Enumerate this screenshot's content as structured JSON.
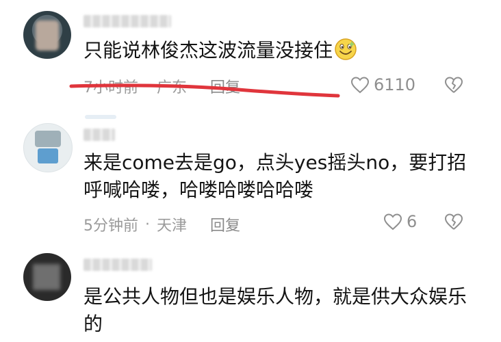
{
  "comments": [
    {
      "text": "只能说林俊杰这波流量没接住",
      "time": "7小时前",
      "sep": "·",
      "location": "广东",
      "reply_label": "回复",
      "likes": "6110"
    },
    {
      "text": "来是come去是go，点头yes摇头no，要打招呼喊哈喽，哈喽哈喽哈哈喽",
      "time": "5分钟前",
      "sep": "·",
      "location": "天津",
      "reply_label": "回复",
      "likes": "6"
    },
    {
      "text": "是公共人物但也是娱乐人物，就是供大众娱乐的"
    }
  ],
  "icons": {
    "like": "heart-outline-icon",
    "dislike": "broken-heart-icon",
    "emoji": "grinning-face-emoji"
  },
  "colors": {
    "strike_line": "#e0353c",
    "meta_text": "#9a9a9a",
    "body_text": "#141414"
  }
}
